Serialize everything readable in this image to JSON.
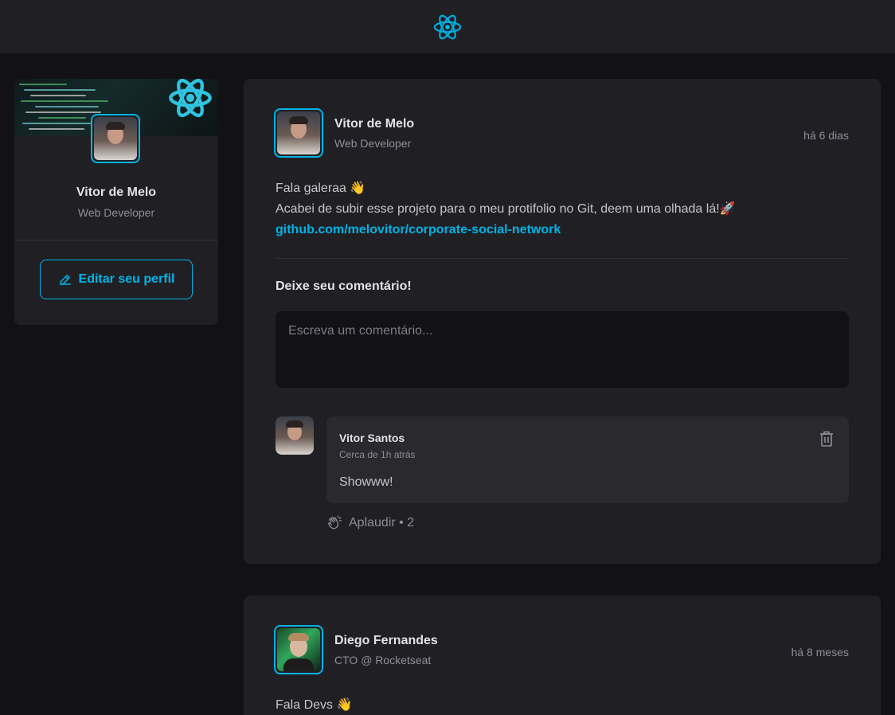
{
  "header": {
    "logo_icon": "react-atom-icon"
  },
  "colors": {
    "accent": "#00b3e6",
    "background": "#121214",
    "card": "#202024",
    "comment_bg": "#29292e",
    "text_muted": "#8d8d99"
  },
  "profile": {
    "name": "Vitor de Melo",
    "role": "Web Developer",
    "edit_label": "Editar seu perfil",
    "edit_icon": "pencil-icon"
  },
  "posts": [
    {
      "author": {
        "name": "Vitor de Melo",
        "role": "Web Developer"
      },
      "time": "há 6 dias",
      "content": {
        "line1": "Fala galeraa 👋",
        "line2": "Acabei de subir esse projeto para o meu protifolio no Git, deem uma olhada lá!🚀",
        "link": "github.com/melovitor/corporate-social-network"
      },
      "comment_title": "Deixe seu comentário!",
      "comment_placeholder": "Escreva um comentário...",
      "comments": [
        {
          "author": "Vitor Santos",
          "time": "Cerca de 1h atrás",
          "text": "Showww!",
          "applaud_label": "Aplaudir • 2"
        }
      ]
    },
    {
      "author": {
        "name": "Diego Fernandes",
        "role": "CTO @ Rocketseat"
      },
      "time": "há 8 meses",
      "content": {
        "line1": "Fala Devs 👋"
      }
    }
  ]
}
